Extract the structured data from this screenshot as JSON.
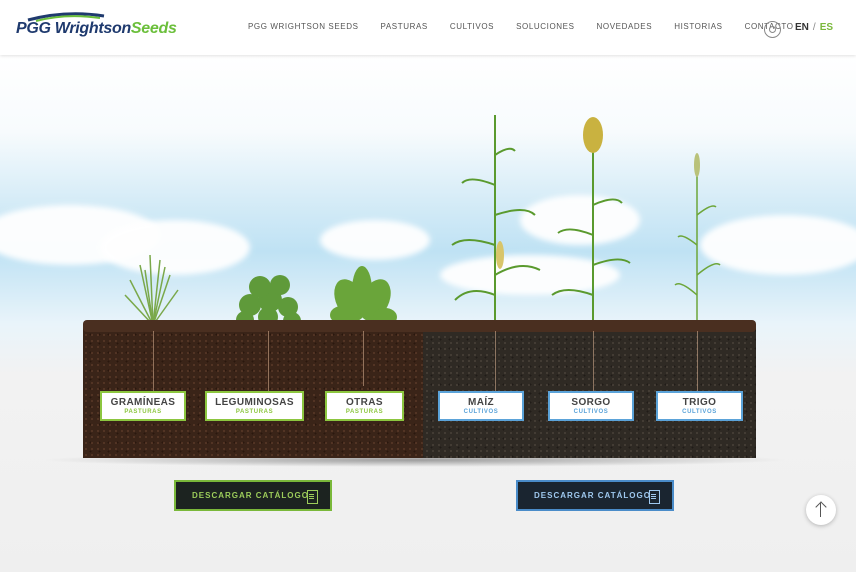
{
  "brand": {
    "logo_text_1": "PGG Wrightson",
    "logo_text_2": "Seeds",
    "logo_icon": "swoosh-icon"
  },
  "nav": {
    "items": [
      {
        "label": "PGG WRIGHTSON SEEDS"
      },
      {
        "label": "PASTURAS"
      },
      {
        "label": "CULTIVOS"
      },
      {
        "label": "SOLUCIONES"
      },
      {
        "label": "NOVEDADES"
      },
      {
        "label": "HISTORIAS"
      },
      {
        "label": "CONTACTO"
      }
    ],
    "search_icon": "search-icon",
    "lang_en": "EN",
    "lang_sep": "/",
    "lang_es": "ES"
  },
  "plants": [
    {
      "name": "GRAMÍNEAS",
      "category": "PASTURAS"
    },
    {
      "name": "LEGUMINOSAS",
      "category": "PASTURAS"
    },
    {
      "name": "OTRAS",
      "category": "PASTURAS"
    },
    {
      "name": "MAÍZ",
      "category": "CULTIVOS"
    },
    {
      "name": "SORGO",
      "category": "CULTIVOS"
    },
    {
      "name": "TRIGO",
      "category": "CULTIVOS"
    }
  ],
  "downloads": {
    "pasturas_label": "DESCARGAR CATÁLOGO",
    "cultivos_label": "DESCARGAR CATÁLOGO",
    "doc_icon": "document-icon"
  },
  "colors": {
    "pasturas": "#8cc63f",
    "cultivos": "#5ba3d9",
    "brand_blue": "#1f3a6e",
    "brand_green": "#6bbf3b"
  },
  "scroll_top_icon": "arrow-up-icon"
}
